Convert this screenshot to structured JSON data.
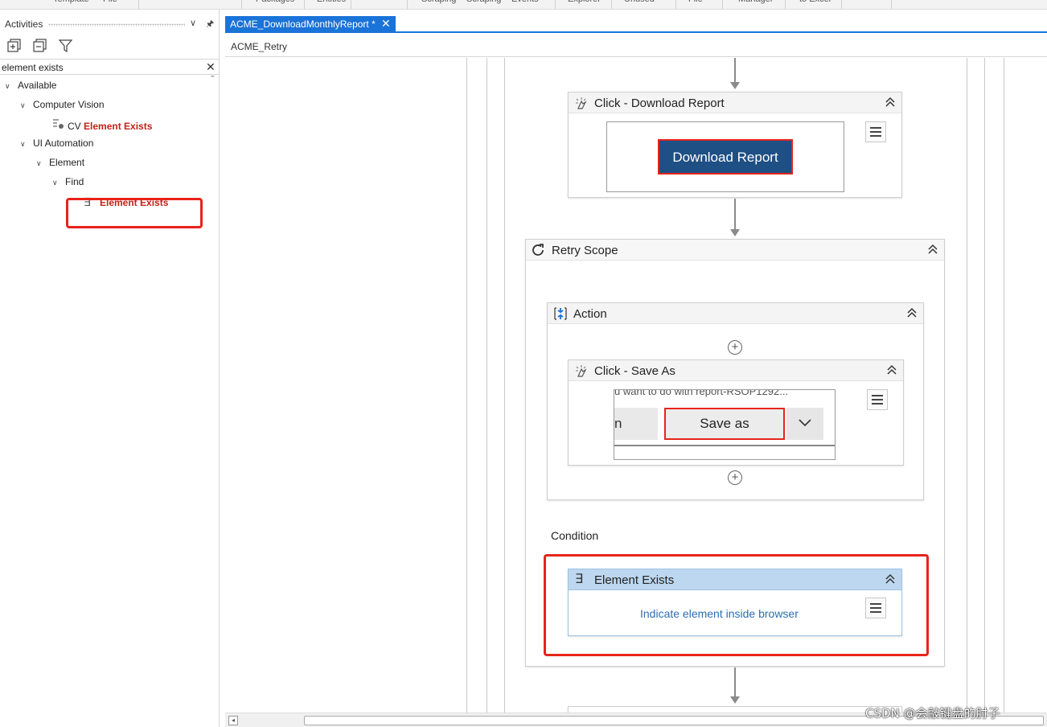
{
  "ribbon": {
    "items": [
      "Template",
      "File",
      "Packages",
      "Entities",
      "Scraping",
      "Scraping",
      "Events",
      "Explorer",
      "Unused",
      "File",
      "Manager",
      "to Excel"
    ]
  },
  "activities_panel": {
    "title": "Activities",
    "search": {
      "value": "element exists"
    },
    "tree": {
      "available": "Available",
      "computer_vision": "Computer Vision",
      "cv_prefix": "CV",
      "cv_element_exists": "Element Exists",
      "ui_automation": "UI Automation",
      "element": "Element",
      "find": "Find",
      "element_exists": "Element Exists"
    }
  },
  "document": {
    "tab_label": "ACME_DownloadMonthlyReport *",
    "breadcrumb": "ACME_Retry"
  },
  "workflow": {
    "click_download": {
      "title": "Click - Download Report",
      "button_label": "Download Report"
    },
    "retry_scope": {
      "title": "Retry Scope"
    },
    "action": {
      "title": "Action"
    },
    "click_save_as": {
      "title": "Click - Save As",
      "preview_top_text": "u want to do with report-RSOP1292...",
      "preview_left_text": "n",
      "save_as_label": "Save as"
    },
    "condition_label": "Condition",
    "element_exists": {
      "title": "Element Exists",
      "indicate_link": "Indicate element inside browser"
    }
  },
  "colors": {
    "accent": "#1a73d8",
    "highlight_red": "#e8231b",
    "download_button": "#1e4f85",
    "element_exists_header": "#bcd7ef",
    "link_blue": "#2d6db5"
  },
  "watermark": "CSDN @会敲键盘的肘子"
}
